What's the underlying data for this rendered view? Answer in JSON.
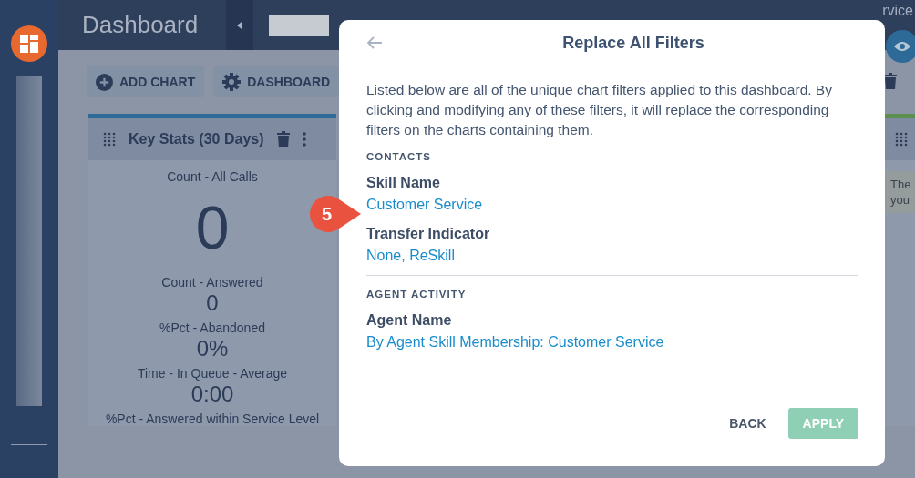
{
  "header": {
    "title": "Dashboard",
    "tabs": [
      {
        "label": "rvice",
        "selected": false
      }
    ]
  },
  "toolbar": {
    "buttons": [
      {
        "label": "ADD CHART",
        "kind": "add"
      },
      {
        "label": "DASHBOARD",
        "kind": "settings"
      }
    ]
  },
  "card": {
    "title": "Key Stats (30 Days)",
    "stats": [
      {
        "label": "Count - All Calls",
        "value": "0",
        "kind": "big"
      },
      {
        "label": "Count - Answered",
        "value": "0",
        "kind": "normal"
      },
      {
        "label": "%Pct - Abandoned",
        "value": "0%",
        "kind": "normal"
      },
      {
        "label": "Time - In Queue - Average",
        "value": "0:00",
        "kind": "normal"
      },
      {
        "label": "%Pct - Answered within Service Level"
      }
    ]
  },
  "side_card": {
    "lines": [
      "The",
      "you"
    ]
  },
  "modal": {
    "title": "Replace All Filters",
    "description": "Listed below are all of the unique chart filters applied to this dashboard. By clicking and modifying any of these filters, it will replace the corresponding filters on the charts containing them.",
    "sections": [
      {
        "heading": "CONTACTS",
        "filters": [
          {
            "name": "Skill Name",
            "value": "Customer Service"
          },
          {
            "name": "Transfer Indicator",
            "value": "None, ReSkill"
          }
        ]
      },
      {
        "heading": "AGENT ACTIVITY",
        "filters": [
          {
            "name": "Agent Name",
            "value": "By Agent Skill Membership: Customer Service"
          }
        ]
      }
    ],
    "buttons": [
      {
        "label": "BACK",
        "kind": "text",
        "disabled": false
      },
      {
        "label": "APPLY",
        "kind": "primary",
        "disabled": true
      }
    ]
  },
  "callout": {
    "number": "5"
  }
}
